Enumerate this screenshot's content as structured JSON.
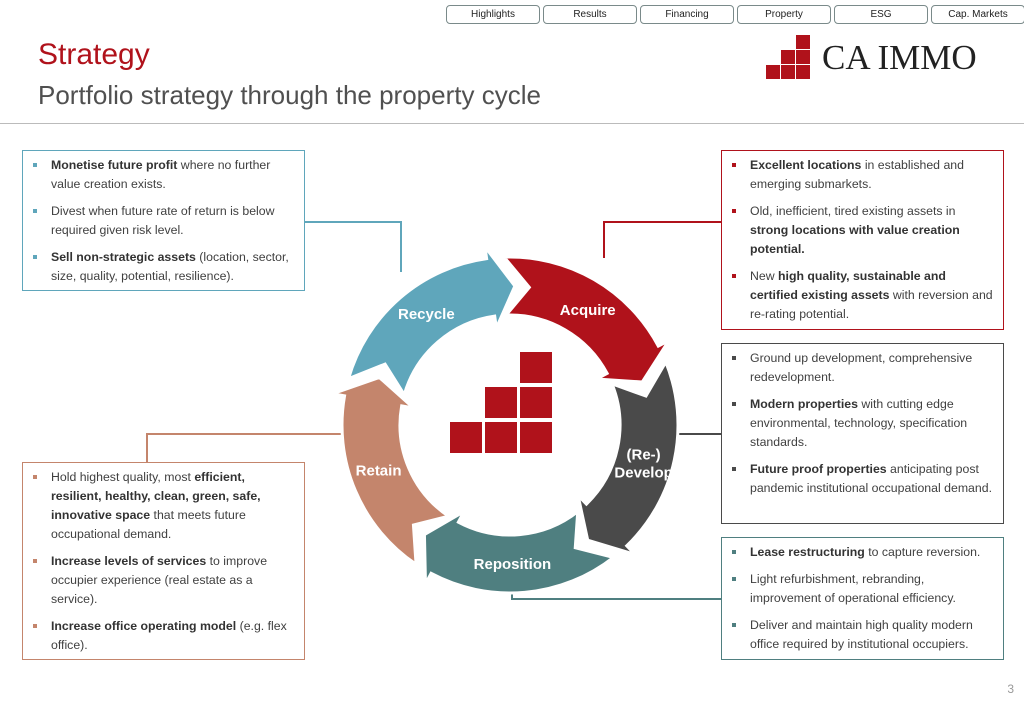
{
  "nav": [
    "Highlights",
    "Results",
    "Financing",
    "Property",
    "ESG",
    "Cap. Markets"
  ],
  "header": {
    "title": "Strategy",
    "subtitle": "Portfolio strategy through the property cycle",
    "logo_text": "CA IMMO"
  },
  "colors": {
    "recycle": "#5fa6bb",
    "acquire": "#b0121b",
    "develop": "#4a4a4a",
    "reposition": "#4f7f80",
    "retain": "#c4856c",
    "accent": "#b0121b"
  },
  "cycle": [
    "Acquire",
    "(Re-)|Develop",
    "Reposition",
    "Retain",
    "Recycle"
  ],
  "boxes": {
    "recycle": [
      [
        {
          "t": "Monetise future profit",
          "b": true
        },
        {
          "t": " where no further value creation exists."
        }
      ],
      [
        {
          "t": "Divest when future rate of return is below required given risk level."
        }
      ],
      [
        {
          "t": "Sell non-strategic assets",
          "b": true
        },
        {
          "t": " (location, sector, size, quality, potential, resilience)."
        }
      ]
    ],
    "acquire": [
      [
        {
          "t": "Excellent locations",
          "b": true
        },
        {
          "t": " in established and emerging submarkets."
        }
      ],
      [
        {
          "t": "Old, inefficient, tired existing assets in "
        },
        {
          "t": "strong locations with value creation potential.",
          "b": true
        }
      ],
      [
        {
          "t": "New "
        },
        {
          "t": "high quality, sustainable and certified existing assets",
          "b": true
        },
        {
          "t": " with reversion and re-rating potential."
        }
      ]
    ],
    "develop": [
      [
        {
          "t": "Ground up development, comprehensive redevelopment."
        }
      ],
      [
        {
          "t": "Modern properties",
          "b": true
        },
        {
          "t": " with cutting edge environmental, technology, specification standards."
        }
      ],
      [
        {
          "t": "Future proof properties",
          "b": true
        },
        {
          "t": " anticipating post pandemic institutional occupational demand."
        }
      ]
    ],
    "reposition": [
      [
        {
          "t": "Lease restructuring",
          "b": true
        },
        {
          "t": " to capture reversion."
        }
      ],
      [
        {
          "t": "Light refurbishment, rebranding, improvement of operational efficiency."
        }
      ],
      [
        {
          "t": "Deliver and maintain high quality modern office required by institutional occupiers."
        }
      ]
    ],
    "retain": [
      [
        {
          "t": "Hold highest quality, most "
        },
        {
          "t": "efficient, resilient, healthy, clean, green, safe, innovative space",
          "b": true
        },
        {
          "t": " that meets future occupational demand."
        }
      ],
      [
        {
          "t": "Increase levels of services",
          "b": true
        },
        {
          "t": " to improve occupier experience (real estate as a service)."
        }
      ],
      [
        {
          "t": "Increase office operating model",
          "b": true
        },
        {
          "t": " (e.g. flex office)."
        }
      ]
    ]
  },
  "page_number": "3"
}
